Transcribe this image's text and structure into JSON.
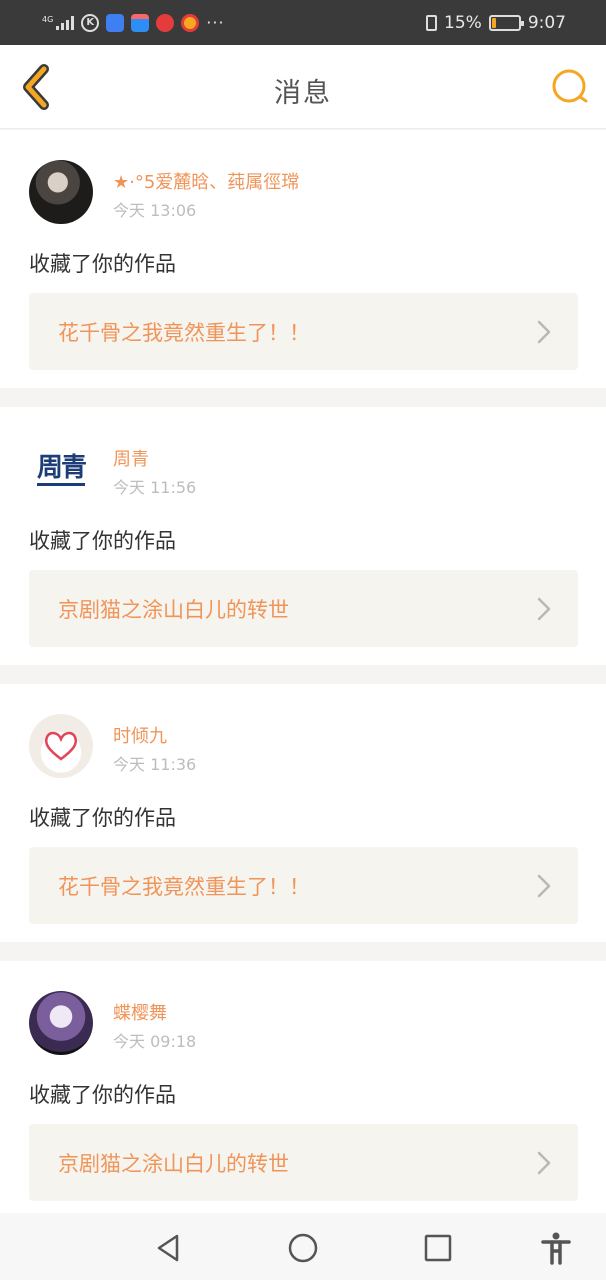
{
  "status_bar": {
    "network": "4G",
    "dots": "···",
    "battery_percent": "15%",
    "battery_level": 0.15,
    "time": "9:07"
  },
  "header": {
    "title": "消息",
    "back_icon": "chevron-left-icon",
    "search_icon": "search-icon",
    "accent_color": "#f5a623"
  },
  "notifications": [
    {
      "user": "★·°5爱麓晗、莼属徑瑺",
      "time": "今天 13:06",
      "action": "收藏了你的作品",
      "work_title": "花千骨之我竟然重生了！！"
    },
    {
      "user": "周青",
      "avatar_text": "周青",
      "time": "今天 11:56",
      "action": "收藏了你的作品",
      "work_title": "京剧猫之涂山白儿的转世"
    },
    {
      "user": "时倾九",
      "time": "今天 11:36",
      "action": "收藏了你的作品",
      "work_title": "花千骨之我竟然重生了！！"
    },
    {
      "user": "蝶樱舞",
      "time": "今天 09:18",
      "action": "收藏了你的作品",
      "work_title": "京剧猫之涂山白儿的转世"
    }
  ],
  "colors": {
    "accent": "#f0955a",
    "work_bg": "#f6f4ee",
    "time_gray": "#bdbdbd"
  }
}
